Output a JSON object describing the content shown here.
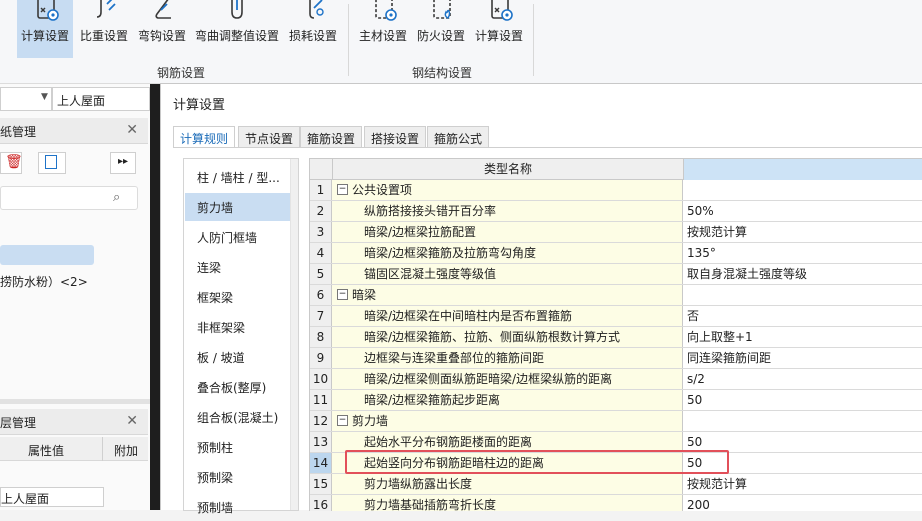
{
  "ribbon": {
    "buttons": [
      {
        "label": "计算设置",
        "icon": "calc-settings-icon"
      },
      {
        "label": "比重设置",
        "icon": "weight-ratio-icon"
      },
      {
        "label": "弯钩设置",
        "icon": "hook-icon"
      },
      {
        "label": "弯曲调整值设置",
        "icon": "bend-adjust-icon"
      },
      {
        "label": "损耗设置",
        "icon": "loss-icon"
      },
      {
        "label": "主材设置",
        "icon": "main-material-icon"
      },
      {
        "label": "防火设置",
        "icon": "fireproof-icon"
      },
      {
        "label": "计算设置",
        "icon": "steel-calc-settings-icon"
      }
    ],
    "groups": [
      "钢筋设置",
      "钢结构设置"
    ]
  },
  "left_panel": {
    "floor_select": "上人屋面",
    "drawing_mgmt_title": "纸管理",
    "list_item_text": "捞防水粉）<2>",
    "layer_mgmt_title": "层管理",
    "col_attr_value": "属性值",
    "col_extra": "附加",
    "attr_first_value": "上人屋面"
  },
  "dialog": {
    "title": "计算设置",
    "tabs": [
      "计算规则",
      "节点设置",
      "箍筋设置",
      "搭接设置",
      "箍筋公式"
    ],
    "categories": [
      "柱 / 墙柱 / 型...",
      "剪力墙",
      "人防门框墙",
      "连梁",
      "框架梁",
      "非框架梁",
      "板 / 坡道",
      "叠合板(整厚)",
      "组合板(混凝土)",
      "预制柱",
      "预制梁",
      "预制墙"
    ],
    "selected_category": "剪力墙",
    "grid_header": "类型名称",
    "rows": [
      {
        "num": "1",
        "name": "公共设置项",
        "value": "",
        "group": true
      },
      {
        "num": "2",
        "name": "纵筋搭接接头错开百分率",
        "value": "50%"
      },
      {
        "num": "3",
        "name": "暗梁/边框梁拉筋配置",
        "value": "按规范计算"
      },
      {
        "num": "4",
        "name": "暗梁/边框梁箍筋及拉筋弯勾角度",
        "value": "135°"
      },
      {
        "num": "5",
        "name": "锚固区混凝土强度等级值",
        "value": "取自身混凝土强度等级"
      },
      {
        "num": "6",
        "name": "暗梁",
        "value": "",
        "group": true
      },
      {
        "num": "7",
        "name": "暗梁/边框梁在中间暗柱内是否布置箍筋",
        "value": "否"
      },
      {
        "num": "8",
        "name": "暗梁/边框梁箍筋、拉筋、侧面纵筋根数计算方式",
        "value": "向上取整+1"
      },
      {
        "num": "9",
        "name": "边框梁与连梁重叠部位的箍筋间距",
        "value": "同连梁箍筋间距"
      },
      {
        "num": "10",
        "name": "暗梁/边框梁侧面纵筋距暗梁/边框梁纵筋的距离",
        "value": "s/2"
      },
      {
        "num": "11",
        "name": "暗梁/边框梁箍筋起步距离",
        "value": "50"
      },
      {
        "num": "12",
        "name": "剪力墙",
        "value": "",
        "group": true
      },
      {
        "num": "13",
        "name": "起始水平分布钢筋距楼面的距离",
        "value": "50"
      },
      {
        "num": "14",
        "name": "起始竖向分布钢筋距暗柱边的距离",
        "value": "50",
        "selected": true
      },
      {
        "num": "15",
        "name": "剪力墙纵筋露出长度",
        "value": "按规范计算"
      },
      {
        "num": "16",
        "name": "剪力墙基础插筋弯折长度",
        "value": "200"
      }
    ]
  }
}
